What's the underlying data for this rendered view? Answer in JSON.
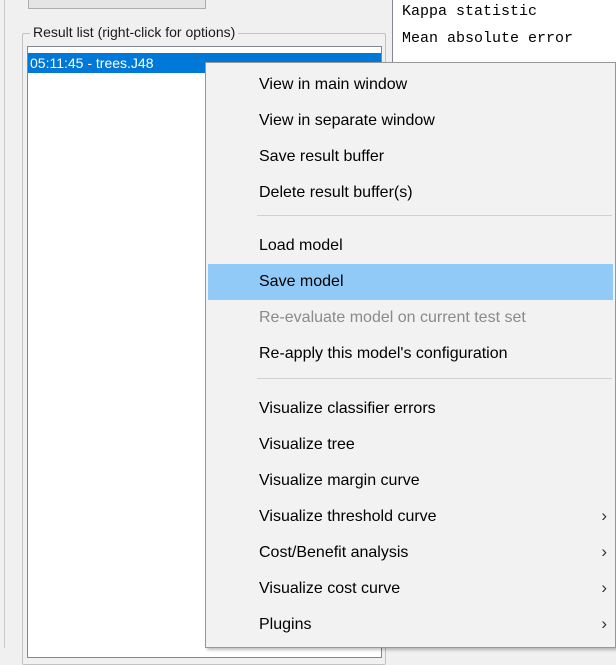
{
  "result_panel": {
    "legend": "Result list (right-click for options)",
    "items": [
      {
        "label": "05:11:45 - trees.J48",
        "selected": true
      }
    ]
  },
  "output": {
    "lines": [
      "Kappa statistic",
      "Mean absolute error"
    ]
  },
  "context_menu": {
    "groups": [
      [
        {
          "label": "View in main window"
        },
        {
          "label": "View in separate window"
        },
        {
          "label": "Save result buffer"
        },
        {
          "label": "Delete result buffer(s)"
        }
      ],
      [
        {
          "label": "Load model"
        },
        {
          "label": "Save model",
          "highlighted": true
        },
        {
          "label": "Re-evaluate model on current test set",
          "disabled": true
        },
        {
          "label": "Re-apply this model's configuration"
        }
      ],
      [
        {
          "label": "Visualize classifier errors"
        },
        {
          "label": "Visualize tree"
        },
        {
          "label": "Visualize margin curve"
        },
        {
          "label": "Visualize threshold curve",
          "submenu": true
        },
        {
          "label": "Cost/Benefit analysis",
          "submenu": true
        },
        {
          "label": "Visualize cost curve",
          "submenu": true
        },
        {
          "label": "Plugins",
          "submenu": true
        }
      ]
    ],
    "submenu_glyph": "›"
  },
  "colors": {
    "selection": "#0078d7",
    "menu_highlight": "#91c9f7",
    "disabled_text": "#8a8a8a"
  }
}
